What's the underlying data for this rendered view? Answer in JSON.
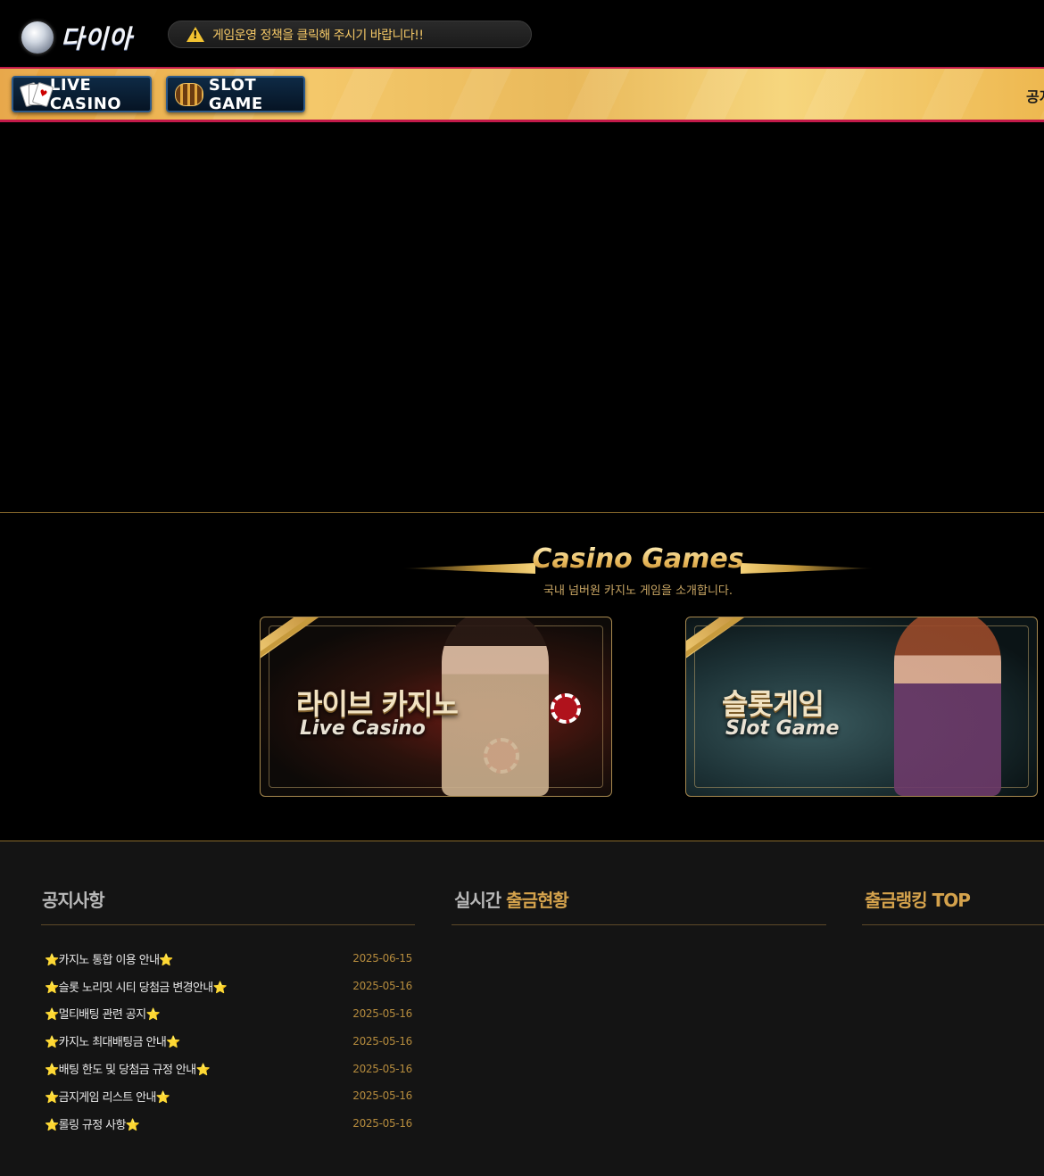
{
  "header": {
    "logo_text": "다이아",
    "notice_text": "게임운영 정책을 클릭해 주시기 바랍니다!!"
  },
  "nav": {
    "live_casino_label": "LIVE CASINO",
    "slot_game_label": "SLOT GAME",
    "marquee_text": "공지"
  },
  "games": {
    "title": "Casino Games",
    "subtitle": "국내 넘버원  카지노 게임을 소개합니다.",
    "cards": [
      {
        "kr": "라이브 카지노",
        "en": "Live Casino"
      },
      {
        "kr": "슬롯게임",
        "en": "Slot Game"
      }
    ]
  },
  "panels": {
    "notice": {
      "title_a": "공지사항",
      "title_b": ""
    },
    "withdrawal": {
      "title_a": "실시간 ",
      "title_b": "출금현황"
    },
    "ranking": {
      "title_a": "",
      "title_b": "출금랭킹 TOP"
    }
  },
  "notices": [
    {
      "title": "⭐카지노 통합 이용 안내⭐",
      "date": "2025-06-15"
    },
    {
      "title": "⭐슬롯 노리밋 시티 당첨금 변경안내⭐",
      "date": "2025-05-16"
    },
    {
      "title": "⭐멀티배팅 관련 공지⭐",
      "date": "2025-05-16"
    },
    {
      "title": "⭐카지노 최대배팅금 안내⭐",
      "date": "2025-05-16"
    },
    {
      "title": "⭐배팅 한도 및 당첨금 규정 안내⭐",
      "date": "2025-05-16"
    },
    {
      "title": "⭐금지게임 리스트 안내⭐",
      "date": "2025-05-16"
    },
    {
      "title": "⭐롤링 규정 사항⭐",
      "date": "2025-05-16"
    }
  ],
  "colors": {
    "accent_gold": "#d4a24c",
    "nav_border": "#c21a4a",
    "notice_text": "#f3c766"
  }
}
